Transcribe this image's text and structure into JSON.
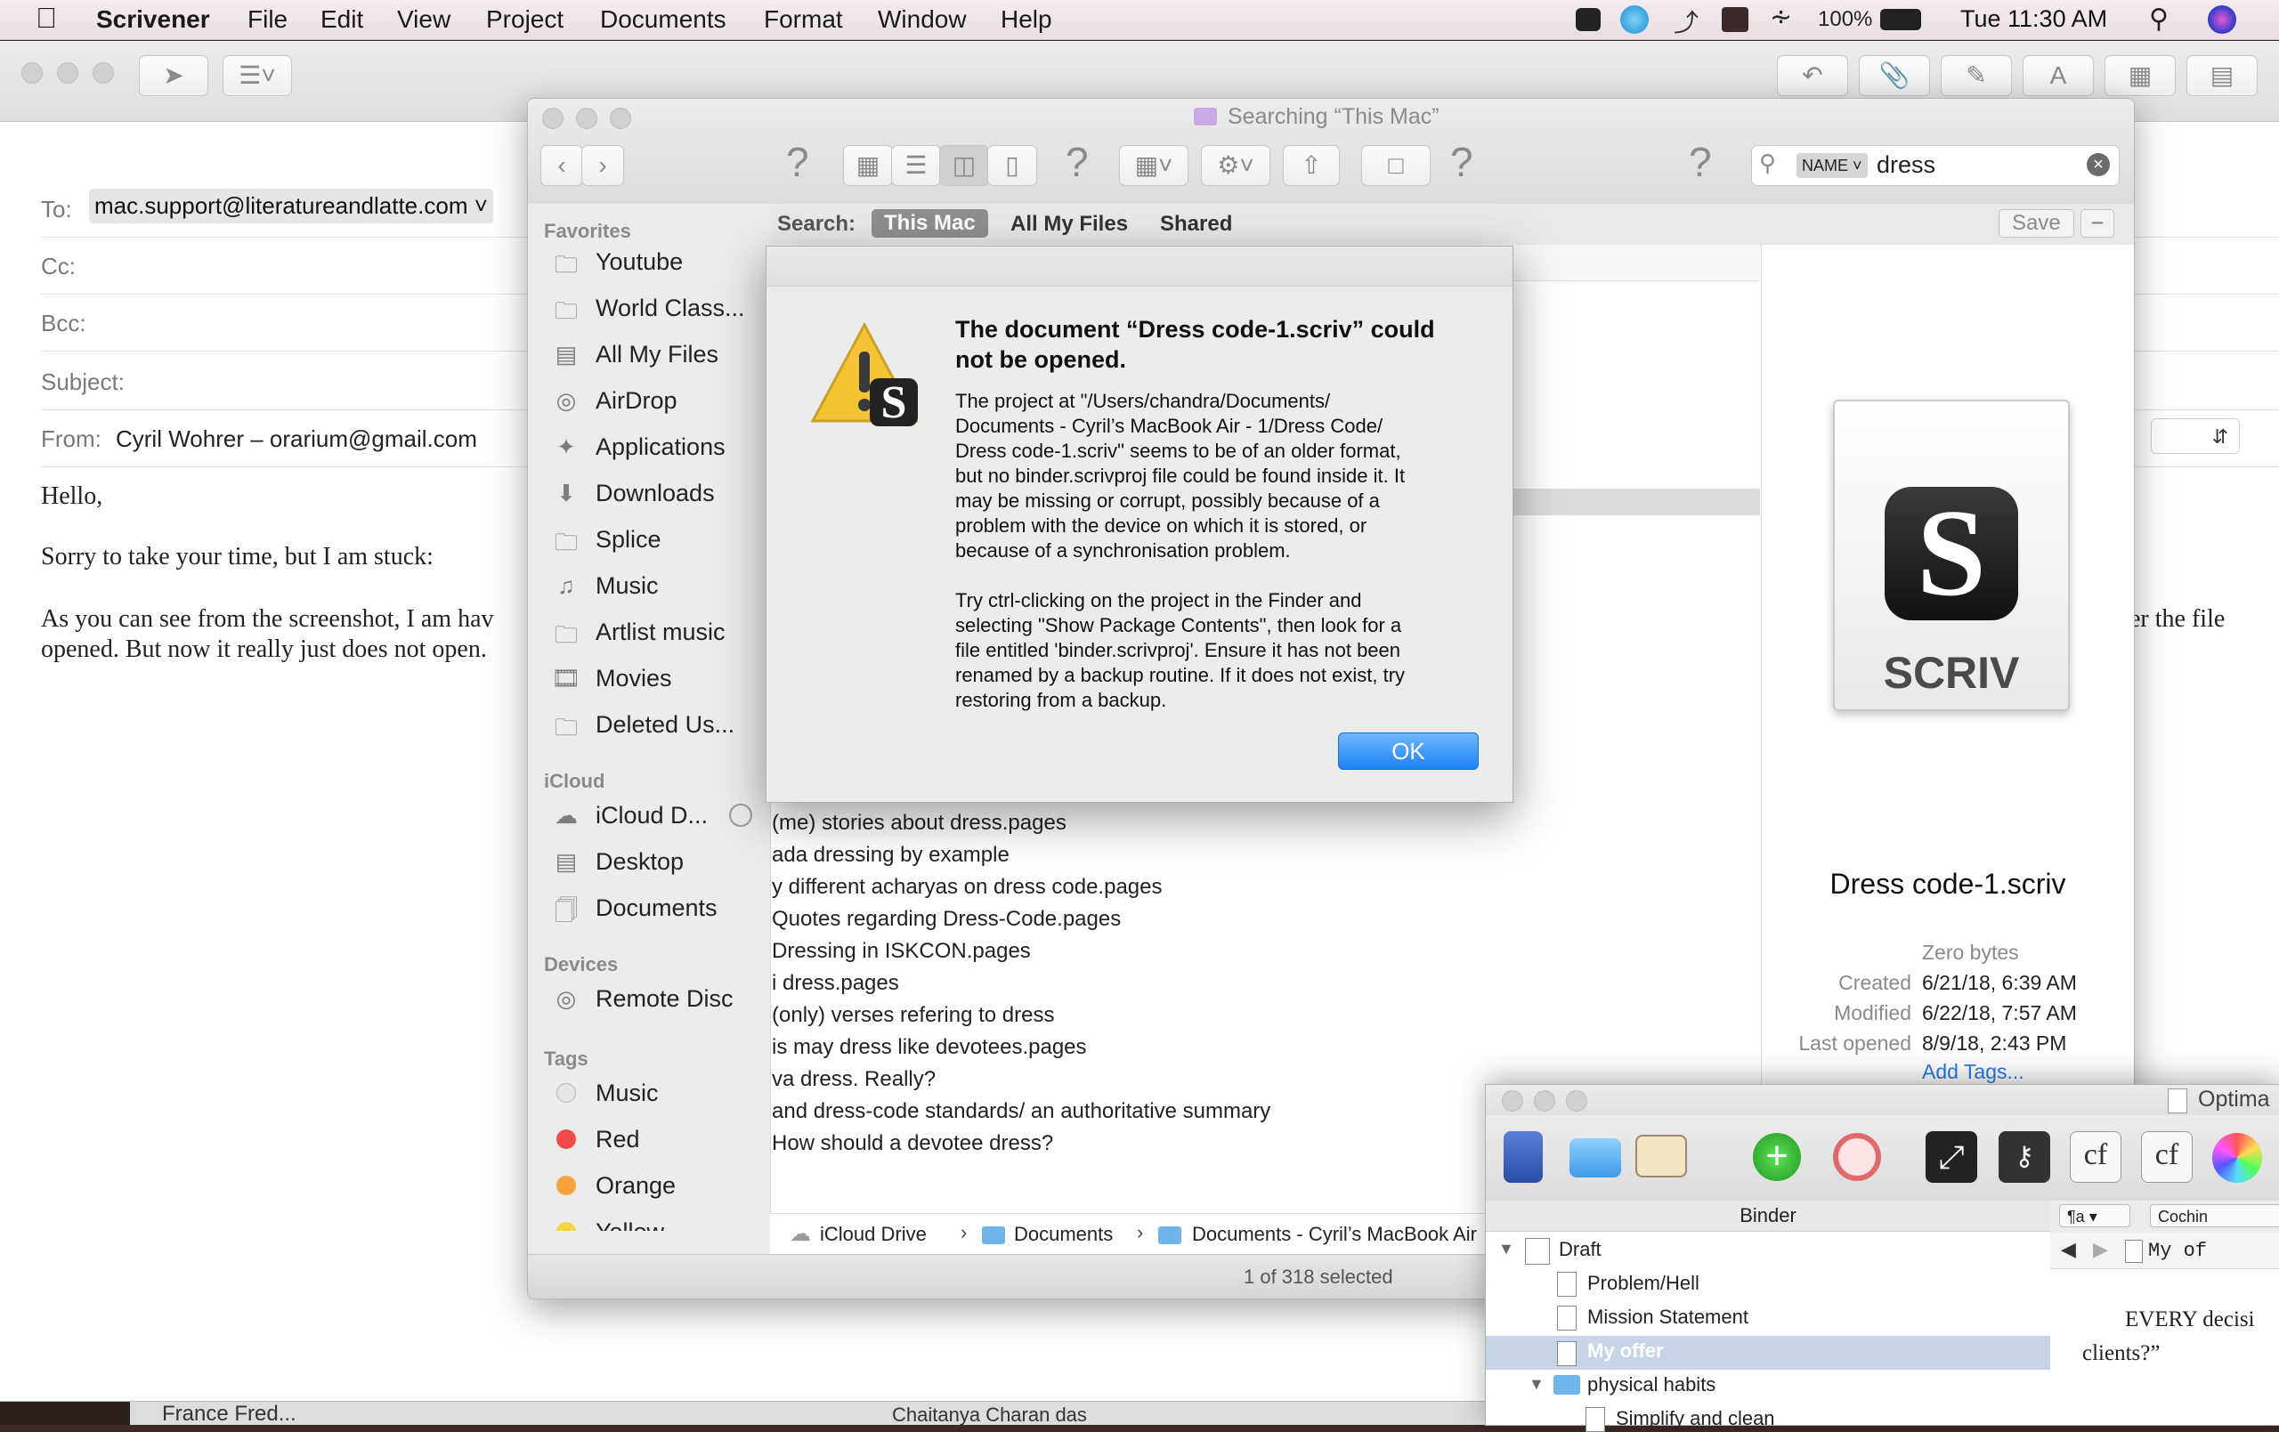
{
  "menubar": {
    "app_name": "Scrivener",
    "menus": [
      "File",
      "Edit",
      "View",
      "Project",
      "Documents",
      "Format",
      "Window",
      "Help"
    ],
    "battery": "100%",
    "clock": "Tue 11:30 AM"
  },
  "mail": {
    "to_label": "To:",
    "to_value": "mac.support@literatureandlatte.com",
    "cc_label": "Cc:",
    "bcc_label": "Bcc:",
    "subject_label": "Subject:",
    "from_label": "From:",
    "from_value": "Cyril Wohrer – orarium@gmail.com",
    "body": {
      "greeting": "Hello,",
      "line1": "Sorry to take your time, but I am stuck:",
      "line2": "As you can see from the screenshot, I am hav",
      "line2_right": "er the file",
      "line3": "opened. But now it really just does not open.",
      "bottom_left": "France Fred...",
      "bottom_mid": "Chaitanya Charan das"
    }
  },
  "finder": {
    "title": "Searching “This Mac”",
    "search_token": "NAME",
    "search_value": "dress",
    "scope_label": "Search:",
    "scopes": [
      "This Mac",
      "All My Files",
      "Shared"
    ],
    "save_label": "Save",
    "sidebar": {
      "favorites_label": "Favorites",
      "favorites": [
        "Youtube",
        "World Class...",
        "All My Files",
        "AirDrop",
        "Applications",
        "Downloads",
        "Splice",
        "Music",
        "Artlist music",
        "Movies",
        "Deleted Us..."
      ],
      "icloud_label": "iCloud",
      "icloud": [
        "iCloud D...",
        "Desktop",
        "Documents"
      ],
      "devices_label": "Devices",
      "devices": [
        "Remote Disc"
      ],
      "tags_label": "Tags",
      "tags": [
        {
          "name": "Music",
          "color": "#d9d9d9"
        },
        {
          "name": "Red",
          "color": "#f04a4a"
        },
        {
          "name": "Orange",
          "color": "#f7a23a"
        },
        {
          "name": "Yellow",
          "color": "#f6d443"
        }
      ]
    },
    "results": [
      "(me) stories about dress.pages",
      "ada dressing by example",
      "y different acharyas on dress code.pages",
      " Quotes regarding Dress-Code.pages",
      "Dressing in ISKCON.pages",
      "i dress.pages",
      "(only) verses refering to dress",
      "is may dress like devotees.pages",
      "va dress. Really?",
      " and dress-code standards/ an authoritative summary",
      " How should a devotee dress?"
    ],
    "path": [
      "iCloud Drive",
      "Documents",
      "Documents - Cyril’s MacBook Air"
    ],
    "status": "1 of 318 selected",
    "preview": {
      "icon_label": "SCRIV",
      "filename": "Dress code-1.scriv",
      "size": "Zero bytes",
      "created_label": "Created",
      "created_value": "6/21/18, 6:39 AM",
      "modified_label": "Modified",
      "modified_value": "6/22/18, 7:57 AM",
      "opened_label": "Last opened",
      "opened_value": "8/9/18, 2:43 PM",
      "add_tags": "Add Tags..."
    }
  },
  "dialog": {
    "title": "The document “Dress code-1.scriv” could not be opened.",
    "message1": "The project at \"/Users/chandra/Documents/\nDocuments - Cyril’s MacBook Air - 1/Dress Code/\nDress code-1.scriv\" seems to be of an older format,\nbut no binder.scrivproj file could be found inside it. It\nmay be missing or corrupt, possibly because of a\nproblem with the device on which it is stored, or\nbecause of a synchronisation problem.",
    "message2": "Try ctrl-clicking on the project in the Finder and\nselecting \"Show Package Contents\", then look for a\nfile entitled 'binder.scrivproj'. Ensure it has not been\nrenamed by a backup routine. If it does not exist, try\nrestoring from a backup.",
    "ok_label": "OK"
  },
  "scrivener": {
    "title": "Optima",
    "binder_label": "Binder",
    "items": [
      {
        "label": "Draft",
        "level": 0
      },
      {
        "label": "Problem/Hell",
        "level": 1
      },
      {
        "label": "Mission Statement",
        "level": 1
      },
      {
        "label": "My offer",
        "level": 1
      },
      {
        "label": "physical habits",
        "level": 1
      },
      {
        "label": "Simplify and clean",
        "level": 2
      }
    ],
    "style_select": "¶a",
    "font_select": "Cochin",
    "doc_title": "My of",
    "editor_line1": "EVERY decisi",
    "editor_line2": "clients?”",
    "cf1": "cf",
    "cf2": "cf"
  },
  "colors": {
    "accent": "#1c84f4",
    "selection": "#c8d5e8"
  }
}
